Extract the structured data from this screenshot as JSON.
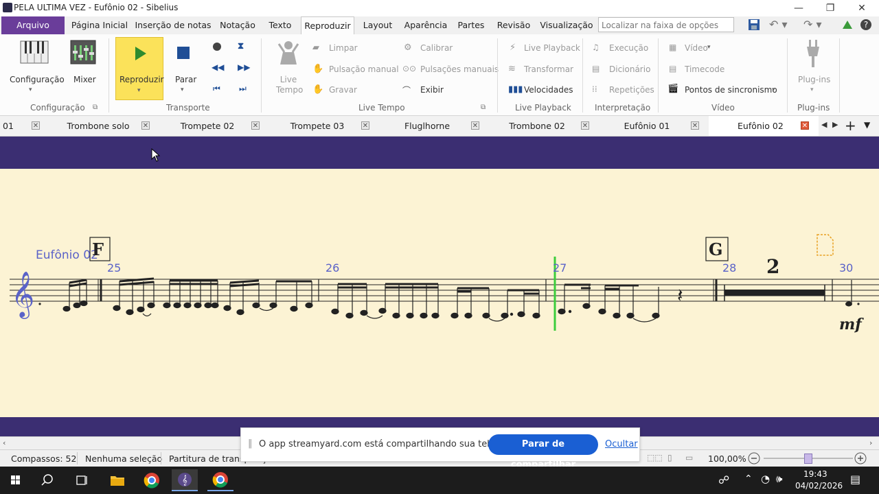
{
  "window": {
    "title": "PELA ULTIMA VEZ - Eufônio 02 - Sibelius",
    "minimize": "—",
    "restore": "❐",
    "close": "✕"
  },
  "ribbon_tabs": [
    "Arquivo",
    "Página Inicial",
    "Inserção de notas",
    "Notação",
    "Texto",
    "Reproduzir",
    "Layout",
    "Aparência",
    "Partes",
    "Revisão",
    "Visualização"
  ],
  "active_tab": "Reproduzir",
  "search": {
    "placeholder": "Localizar na faixa de opções"
  },
  "groups": {
    "configuracao": {
      "label": "Configuração",
      "items": [
        "Configuração",
        "Mixer"
      ]
    },
    "transporte": {
      "label": "Transporte",
      "play": "Reproduzir",
      "stop": "Parar"
    },
    "live_tempo": {
      "label": "Live Tempo",
      "live_tempo": "Live Tempo",
      "limpar": "Limpar",
      "pulsacao": "Pulsação manual",
      "gravar": "Gravar",
      "calibrar": "Calibrar",
      "pulsacoes": "Pulsações manuais",
      "exibir": "Exibir"
    },
    "live_playback": {
      "label": "Live Playback",
      "live_playback": "Live Playback",
      "transformar": "Transformar",
      "velocidades": "Velocidades"
    },
    "interpretacao": {
      "label": "Interpretação",
      "execucao": "Execução",
      "dicionario": "Dicionário",
      "repeticoes": "Repetições"
    },
    "video": {
      "label": "Vídeo",
      "video": "Vídeo",
      "timecode": "Timecode",
      "sync": "Pontos de sincronismo"
    },
    "plugins": {
      "label": "Plug-ins",
      "plugins": "Plug-ins"
    }
  },
  "score_tabs": [
    "01",
    "Trombone solo",
    "Trompete 02",
    "Trompete 03",
    "Fluglhorne",
    "Trombone 02",
    "Eufônio 01",
    "Eufônio 02"
  ],
  "active_score_tab": "Eufônio 02",
  "score": {
    "instrument": "Eufônio 02",
    "rehearsal_marks": [
      "F",
      "G"
    ],
    "bar_numbers": [
      "25",
      "26",
      "27",
      "28",
      "30"
    ],
    "multirest_count": "2",
    "dynamic": "mf"
  },
  "status": {
    "compassos": "Compassos: 52",
    "selecao": "Nenhuma seleção",
    "partitura": "Partitura de transposição",
    "zoom": "100,00%"
  },
  "share": {
    "message": "O app streamyard.com está compartilhando sua tela e áudio.",
    "stop": "Parar de compartilhar",
    "hide": "Ocultar"
  },
  "clock": {
    "time": "19:43",
    "date": "04/02/2026"
  },
  "colors": {
    "file_tab": "#6a3d9a",
    "score_band": "#3b2e72",
    "paper": "#fcf3d4",
    "playback_line": "#3ccc3c",
    "share_button": "#1a5fd3"
  }
}
